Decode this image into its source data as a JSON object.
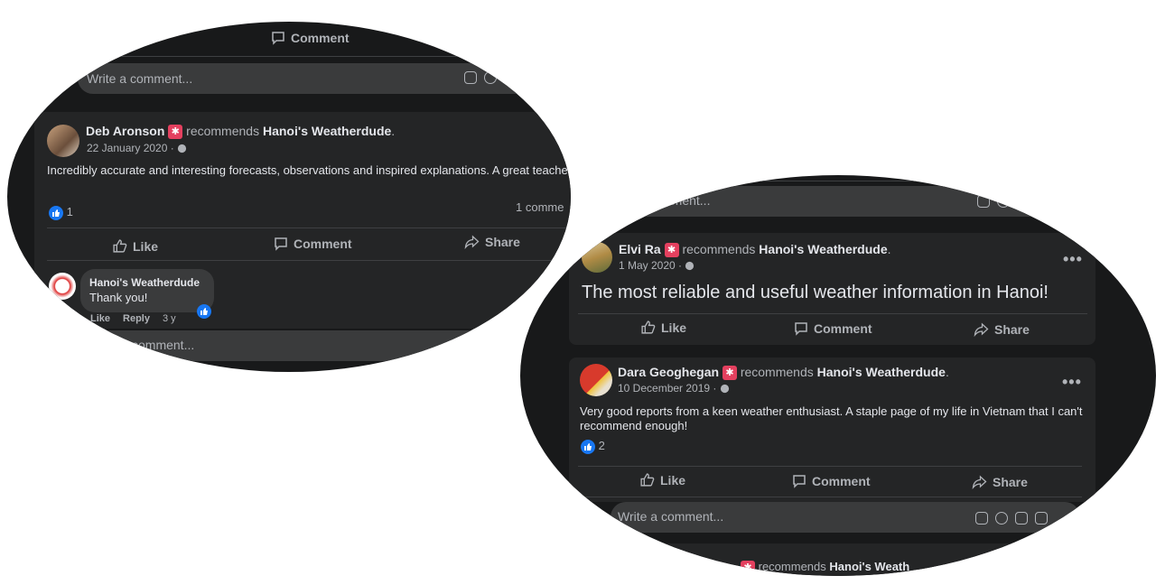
{
  "left_panel": {
    "top_comment_label": "Comment",
    "write_placeholder": "Write a comment...",
    "post": {
      "author": "Deb Aronson",
      "recommends": "recommends",
      "page": "Hanoi's Weatherdude",
      "period": ".",
      "date": "22 January 2020 ·",
      "text": "Incredibly accurate and interesting forecasts, observations and inspired explanations.  A great teacher.",
      "like_count": "1",
      "comments_count": "1 comme",
      "actions": {
        "like": "Like",
        "comment": "Comment",
        "share": "Share"
      }
    },
    "reply": {
      "author": "Hanoi's Weatherdude",
      "text": "Thank you!",
      "like": "Like",
      "reply": "Reply",
      "time": "3 y"
    },
    "bottom_placeholder": "comment..."
  },
  "right_panel": {
    "top_placeholder": "mment...",
    "post1": {
      "author": "Elvi Ra",
      "recommends": "recommends",
      "page": "Hanoi's Weatherdude",
      "period": ".",
      "date": "1 May 2020 ·",
      "text": "The most reliable and useful weather information in Hanoi!",
      "more": "•••",
      "actions": {
        "like": "Like",
        "comment": "Comment",
        "share": "Share"
      }
    },
    "post2": {
      "author": "Dara Geoghegan",
      "recommends": "recommends",
      "page": "Hanoi's Weatherdude",
      "period": ".",
      "date": "10 December 2019 ·",
      "text": "Very good reports from a keen weather enthusiast. A staple page of my life in Vietnam that I can't recommend enough!",
      "like_count": "2",
      "more": "•••",
      "actions": {
        "like": "Like",
        "comment": "Comment",
        "share": "Share"
      }
    },
    "write_placeholder": "Write a comment...",
    "partial_next": {
      "recommends": "recommends",
      "page": "Hanoi's Weath"
    }
  },
  "colors": {
    "background": "#18191a",
    "card": "#242526",
    "input": "#3a3b3c",
    "like_blue": "#1877f2",
    "badge": "#e4405f"
  }
}
